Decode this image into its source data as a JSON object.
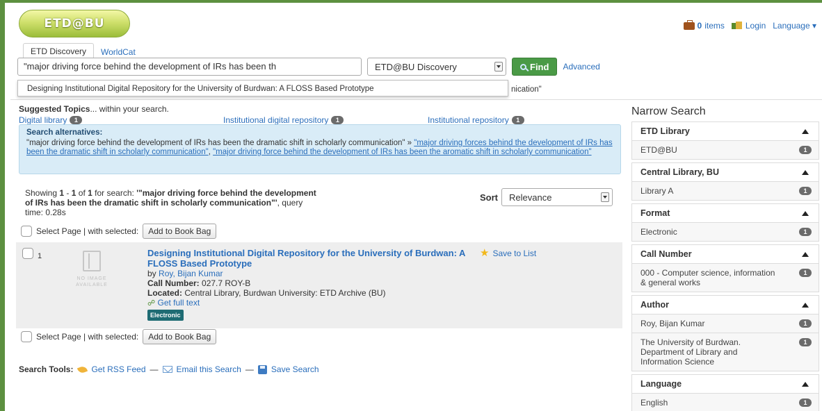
{
  "header": {
    "logo": "ETD@BU",
    "items_count": "0",
    "items_label": "items",
    "login": "Login",
    "language": "Language ▾"
  },
  "tabs": [
    {
      "label": "ETD Discovery",
      "active": true
    },
    {
      "label": "WorldCat",
      "active": false
    }
  ],
  "search": {
    "query": "\"major driving force behind the development of  IRs has been th",
    "scope": "ETD@BU Discovery",
    "find_label": "Find",
    "advanced_label": "Advanced"
  },
  "autocomplete": {
    "suggestion": "Designing Institutional Digital Repository for the University of Burdwan: A FLOSS Based Prototype",
    "behind_text": "nication\""
  },
  "suggested_topics": {
    "title": "Suggested Topics",
    "within": "... within your search.",
    "items": [
      {
        "label": "Digital library",
        "count": "1"
      },
      {
        "label": "Institutional digital repository",
        "count": "1"
      },
      {
        "label": "Institutional repository",
        "count": "1"
      }
    ]
  },
  "alternatives": {
    "heading": "Search alternatives:",
    "original": "\"major driving force behind the development of IRs has been the dramatic shift in scholarly communication\" »",
    "alt1": "\"major driving forces behind the development of IRs has been the dramatic shift in scholarly communication\"",
    "comma": ",",
    "alt2": "\"major driving force behind the development of IRs has been the aromatic shift in scholarly communication\""
  },
  "results_summary": {
    "showing": "Showing",
    "from": "1",
    "dash": "-",
    "to": "1",
    "of": "of",
    "total": "1",
    "for_search": "for search:",
    "query": "'\"major driving force behind the development of IRs has been the dramatic shift in scholarly communication\"'",
    "query_time": ", query time: 0.28s"
  },
  "sort": {
    "label": "Sort",
    "value": "Relevance"
  },
  "bulk": {
    "select_label": "Select Page | with selected:",
    "add_button": "Add to Book Bag"
  },
  "result": {
    "number": "1",
    "no_image": "NO IMAGE AVAILABLE",
    "title": "Designing Institutional Digital Repository for the University of Burdwan: A FLOSS Based Prototype",
    "by": "by",
    "author": "Roy, Bijan Kumar",
    "call_label": "Call Number:",
    "call_value": "027.7 ROY-B",
    "located_label": "Located:",
    "located_value": "Central Library, Burdwan University: ETD Archive (BU)",
    "full_text": "Get full text",
    "format": "Electronic",
    "save_to_list": "Save to List"
  },
  "tools": {
    "label": "Search Tools:",
    "rss": "Get RSS Feed",
    "sep": "—",
    "email": "Email this Search",
    "save": "Save Search"
  },
  "sidebar": {
    "title": "Narrow Search",
    "facets": [
      {
        "heading": "ETD Library",
        "items": [
          {
            "label": "ETD@BU",
            "count": "1"
          }
        ]
      },
      {
        "heading": "Central Library, BU",
        "items": [
          {
            "label": "Library A",
            "count": "1"
          }
        ]
      },
      {
        "heading": "Format",
        "items": [
          {
            "label": "Electronic",
            "count": "1"
          }
        ]
      },
      {
        "heading": "Call Number",
        "items": [
          {
            "label": "000 - Computer science, information & general works",
            "count": "1"
          }
        ]
      },
      {
        "heading": "Author",
        "items": [
          {
            "label": "Roy, Bijan Kumar",
            "count": "1"
          },
          {
            "label": "The University of Burdwan. Department of Library and Information Science",
            "count": "1"
          }
        ]
      },
      {
        "heading": "Language",
        "items": [
          {
            "label": "English",
            "count": "1"
          }
        ]
      }
    ]
  },
  "colors": {
    "accent_green": "#5d9040",
    "link": "#2a6ebb",
    "find_button": "#4a9a46",
    "alternatives_bg": "#d9ecf7",
    "format_badge": "#1e6b73"
  }
}
